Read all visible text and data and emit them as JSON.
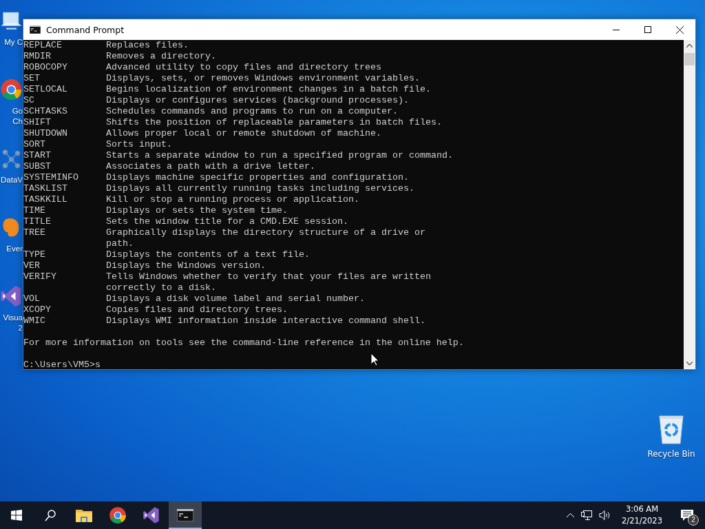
{
  "desktop_icons": [
    {
      "kind": "computer",
      "label_lines": [
        "My C"
      ]
    },
    {
      "kind": "chrome",
      "label_lines": [
        "Go",
        "Ch"
      ]
    },
    {
      "kind": "dataviz",
      "label_lines": [
        "DataV"
      ]
    },
    {
      "kind": "evernote",
      "label_lines": [
        "Ever"
      ]
    },
    {
      "kind": "vstudio",
      "label_lines": [
        "Visua",
        "2"
      ]
    }
  ],
  "recycle_bin": {
    "label": "Recycle Bin"
  },
  "window": {
    "title": "Command Prompt",
    "console": {
      "rows": [
        {
          "command": "REPLACE",
          "lines": [
            "Replaces files."
          ]
        },
        {
          "command": "RMDIR",
          "lines": [
            "Removes a directory."
          ]
        },
        {
          "command": "ROBOCOPY",
          "lines": [
            "Advanced utility to copy files and directory trees"
          ]
        },
        {
          "command": "SET",
          "lines": [
            "Displays, sets, or removes Windows environment variables."
          ]
        },
        {
          "command": "SETLOCAL",
          "lines": [
            "Begins localization of environment changes in a batch file."
          ]
        },
        {
          "command": "SC",
          "lines": [
            "Displays or configures services (background processes)."
          ]
        },
        {
          "command": "SCHTASKS",
          "lines": [
            "Schedules commands and programs to run on a computer."
          ]
        },
        {
          "command": "SHIFT",
          "lines": [
            "Shifts the position of replaceable parameters in batch files."
          ]
        },
        {
          "command": "SHUTDOWN",
          "lines": [
            "Allows proper local or remote shutdown of machine."
          ]
        },
        {
          "command": "SORT",
          "lines": [
            "Sorts input."
          ]
        },
        {
          "command": "START",
          "lines": [
            "Starts a separate window to run a specified program or command."
          ]
        },
        {
          "command": "SUBST",
          "lines": [
            "Associates a path with a drive letter."
          ]
        },
        {
          "command": "SYSTEMINFO",
          "lines": [
            "Displays machine specific properties and configuration."
          ]
        },
        {
          "command": "TASKLIST",
          "lines": [
            "Displays all currently running tasks including services."
          ]
        },
        {
          "command": "TASKKILL",
          "lines": [
            "Kill or stop a running process or application."
          ]
        },
        {
          "command": "TIME",
          "lines": [
            "Displays or sets the system time."
          ]
        },
        {
          "command": "TITLE",
          "lines": [
            "Sets the window title for a CMD.EXE session."
          ]
        },
        {
          "command": "TREE",
          "lines": [
            "Graphically displays the directory structure of a drive or",
            "path."
          ]
        },
        {
          "command": "TYPE",
          "lines": [
            "Displays the contents of a text file."
          ]
        },
        {
          "command": "VER",
          "lines": [
            "Displays the Windows version."
          ]
        },
        {
          "command": "VERIFY",
          "lines": [
            "Tells Windows whether to verify that your files are written",
            "correctly to a disk."
          ]
        },
        {
          "command": "VOL",
          "lines": [
            "Displays a disk volume label and serial number."
          ]
        },
        {
          "command": "XCOPY",
          "lines": [
            "Copies files and directory trees."
          ]
        },
        {
          "command": "WMIC",
          "lines": [
            "Displays WMI information inside interactive command shell."
          ]
        }
      ],
      "footer": "For more information on tools see the command-line reference in the online help.",
      "prompt": "C:\\Users\\VM5>s"
    }
  },
  "taskbar": {
    "pinned": [
      {
        "kind": "explorer",
        "selected": false
      },
      {
        "kind": "chrome",
        "selected": false
      },
      {
        "kind": "vstudio",
        "selected": false
      },
      {
        "kind": "cmd",
        "selected": true
      }
    ],
    "clock": {
      "time": "3:06 AM",
      "date": "2/21/2023"
    },
    "notifications": {
      "count": "2"
    }
  }
}
